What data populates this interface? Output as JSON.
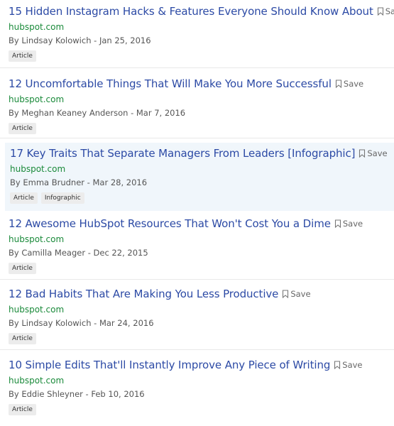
{
  "save_label": "Save",
  "results": [
    {
      "title": "15 Hidden Instagram Hacks & Features Everyone Should Know About",
      "domain": "hubspot.com",
      "byline": "By Lindsay Kolowich - Jan 25, 2016",
      "tags": [
        "Article"
      ]
    },
    {
      "title": "12 Uncomfortable Things That Will Make You More Successful",
      "domain": "hubspot.com",
      "byline": "By Meghan Keaney Anderson - Mar 7, 2016",
      "tags": [
        "Article"
      ]
    },
    {
      "title": "17 Key Traits That Separate Managers From Leaders [Infographic]",
      "domain": "hubspot.com",
      "byline": "By Emma Brudner - Mar 28, 2016",
      "tags": [
        "Article",
        "Infographic"
      ]
    },
    {
      "title": "12 Awesome HubSpot Resources That Won't Cost You a Dime",
      "domain": "hubspot.com",
      "byline": "By Camilla Meager - Dec 22, 2015",
      "tags": [
        "Article"
      ]
    },
    {
      "title": "12 Bad Habits That Are Making You Less Productive",
      "domain": "hubspot.com",
      "byline": "By Lindsay Kolowich - Mar 24, 2016",
      "tags": [
        "Article"
      ]
    },
    {
      "title": "10 Simple Edits That'll Instantly Improve Any Piece of Writing",
      "domain": "hubspot.com",
      "byline": "By Eddie Shleyner - Feb 10, 2016",
      "tags": [
        "Article"
      ]
    }
  ]
}
